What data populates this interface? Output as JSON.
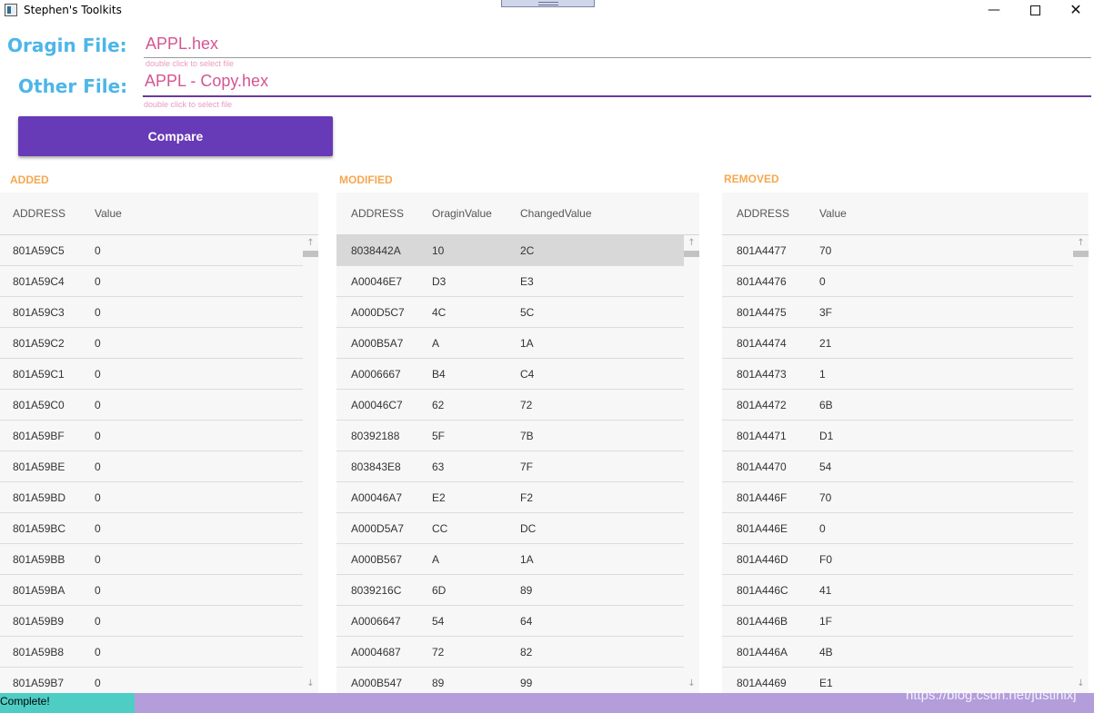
{
  "window": {
    "title": "Stephen's Toolkits",
    "minimize": "—",
    "close": "✕"
  },
  "origin": {
    "label": "Oragin File:",
    "value": "APPL.hex",
    "hint": "double click to select file"
  },
  "other": {
    "label": "Other File:",
    "value": "APPL - Copy.hex",
    "hint": "double click to select file"
  },
  "compare_label": "Compare",
  "added": {
    "title": "ADDED",
    "columns": [
      "ADDRESS",
      "Value"
    ],
    "rows": [
      [
        "801A59C5",
        "0"
      ],
      [
        "801A59C4",
        "0"
      ],
      [
        "801A59C3",
        "0"
      ],
      [
        "801A59C2",
        "0"
      ],
      [
        "801A59C1",
        "0"
      ],
      [
        "801A59C0",
        "0"
      ],
      [
        "801A59BF",
        "0"
      ],
      [
        "801A59BE",
        "0"
      ],
      [
        "801A59BD",
        "0"
      ],
      [
        "801A59BC",
        "0"
      ],
      [
        "801A59BB",
        "0"
      ],
      [
        "801A59BA",
        "0"
      ],
      [
        "801A59B9",
        "0"
      ],
      [
        "801A59B8",
        "0"
      ],
      [
        "801A59B7",
        "0"
      ]
    ]
  },
  "modified": {
    "title": "MODIFIED",
    "columns": [
      "ADDRESS",
      "OraginValue",
      "ChangedValue"
    ],
    "rows": [
      [
        "8038442A",
        "10",
        "2C"
      ],
      [
        "A00046E7",
        "D3",
        "E3"
      ],
      [
        "A000D5C7",
        "4C",
        "5C"
      ],
      [
        "A000B5A7",
        "A",
        "1A"
      ],
      [
        "A0006667",
        "B4",
        "C4"
      ],
      [
        "A00046C7",
        "62",
        "72"
      ],
      [
        "80392188",
        "5F",
        "7B"
      ],
      [
        "803843E8",
        "63",
        "7F"
      ],
      [
        "A00046A7",
        "E2",
        "F2"
      ],
      [
        "A000D5A7",
        "CC",
        "DC"
      ],
      [
        "A000B567",
        "A",
        "1A"
      ],
      [
        "8039216C",
        "6D",
        "89"
      ],
      [
        "A0006647",
        "54",
        "64"
      ],
      [
        "A0004687",
        "72",
        "82"
      ],
      [
        "A000B547",
        "89",
        "99"
      ]
    ]
  },
  "removed": {
    "title": "REMOVED",
    "columns": [
      "ADDRESS",
      "Value"
    ],
    "rows": [
      [
        "801A4477",
        "70"
      ],
      [
        "801A4476",
        "0"
      ],
      [
        "801A4475",
        "3F"
      ],
      [
        "801A4474",
        "21"
      ],
      [
        "801A4473",
        "1"
      ],
      [
        "801A4472",
        "6B"
      ],
      [
        "801A4471",
        "D1"
      ],
      [
        "801A4470",
        "54"
      ],
      [
        "801A446F",
        "70"
      ],
      [
        "801A446E",
        "0"
      ],
      [
        "801A446D",
        "F0"
      ],
      [
        "801A446C",
        "41"
      ],
      [
        "801A446B",
        "1F"
      ],
      [
        "801A446A",
        "4B"
      ],
      [
        "801A4469",
        "E1"
      ]
    ]
  },
  "status": {
    "text": "Complete!",
    "progress": 0.123
  },
  "watermark": "https://blog.csdn.net/justinlxj"
}
